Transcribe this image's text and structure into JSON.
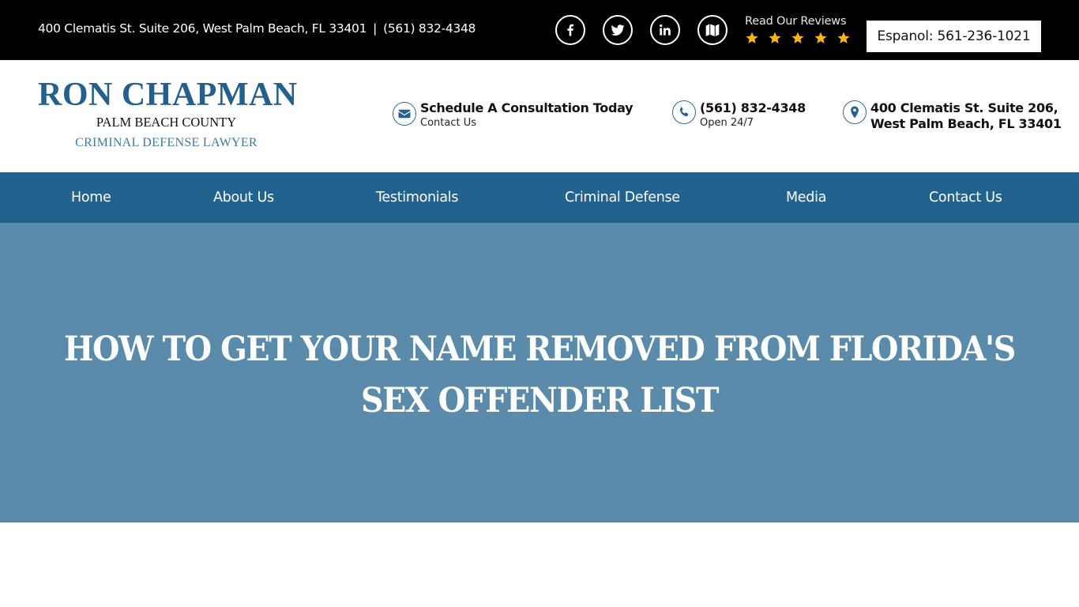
{
  "topbar": {
    "address": "400 Clematis St. Suite 206, West Palm Beach, FL 33401",
    "separator": "|",
    "phone": "(561) 832-4348",
    "social": [
      {
        "name": "facebook",
        "icon": "facebook-icon"
      },
      {
        "name": "twitter",
        "icon": "twitter-icon"
      },
      {
        "name": "linkedin",
        "icon": "linkedin-icon"
      },
      {
        "name": "map",
        "icon": "map-icon"
      }
    ],
    "reviews_label": "Read Our Reviews",
    "star_rating": 5,
    "star_color": "#f6b619",
    "espanol_button": "Espanol: 561-236-1021"
  },
  "header": {
    "logo": {
      "name": "RON CHAPMAN",
      "county": "PALM BEACH COUNTY",
      "tagline": "CRIMINAL DEFENSE LAWYER"
    },
    "schedule": {
      "title": "Schedule A Consultation Today",
      "subtitle": "Contact Us",
      "icon": "envelope-icon"
    },
    "phone": {
      "title": "(561) 832-4348",
      "subtitle": "Open 24/7",
      "icon": "phone-icon"
    },
    "address": {
      "line1": "400 Clematis St. Suite 206,",
      "line2": "West Palm Beach, FL 33401",
      "icon": "location-pin-icon"
    }
  },
  "nav": {
    "items": [
      {
        "label": "Home"
      },
      {
        "label": "About Us"
      },
      {
        "label": "Testimonials"
      },
      {
        "label": "Criminal Defense"
      },
      {
        "label": "Media"
      },
      {
        "label": "Contact Us"
      }
    ]
  },
  "hero": {
    "title": "HOW TO GET YOUR NAME REMOVED FROM FLORIDA'S SEX OFFENDER LIST"
  },
  "colors": {
    "topbar_bg": "#000000",
    "brand_blue": "#23608c",
    "nav_bg": "#21628f",
    "hero_bg": "#5a8bab"
  }
}
